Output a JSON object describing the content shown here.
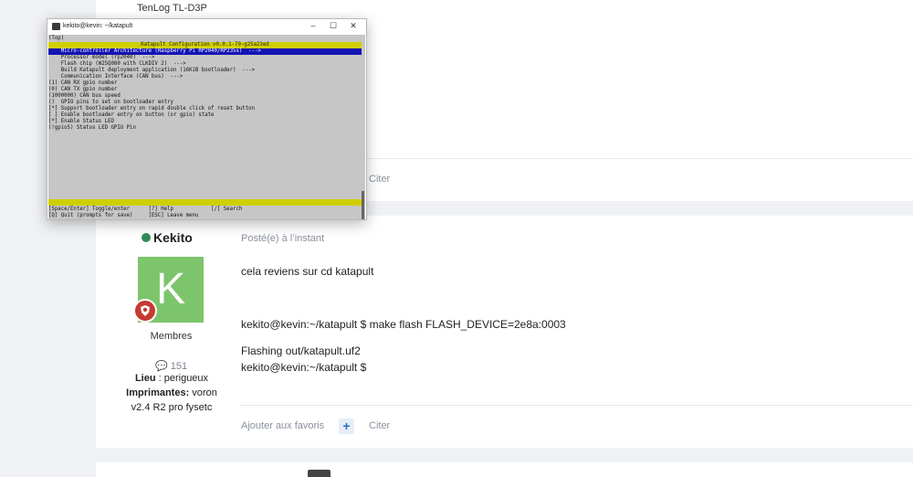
{
  "top_post": {
    "printer_name": "TenLog TL-D3P",
    "cite_label": "Citer"
  },
  "main_post": {
    "author": "Kekito",
    "avatar_letter": "K",
    "group": "Membres",
    "post_count": "151",
    "location_label": "Lieu",
    "location_value": " : perigueux",
    "printers_label": "Imprimantes:",
    "printers_value": " voron",
    "printers_value2": "v2.4 R2 pro fysetc",
    "posted": "Posté(e) à l’instant",
    "lines": [
      "cela reviens sur cd katapult",
      "kekito@kevin:~/katapult $ make flash FLASH_DEVICE=2e8a:0003",
      " Flashing out/katapult.uf2",
      "kekito@kevin:~/katapult $"
    ],
    "favorite_label": "Ajouter aux favoris",
    "plus_label": "+",
    "cite_label": "Citer"
  },
  "terminal_window": {
    "title": "kekito@kevin: ~/katapult",
    "controls": {
      "minimize": "–",
      "maximize": "☐",
      "close": "✕"
    },
    "top_tag": "(Top)",
    "config_title": "Katapult Configuration v0.0.1-79-g25a23ed",
    "lines": [
      "    Micro-controller Architecture (Raspberry Pi RP2040/RP235x)  --->",
      "    Processor model (rp2040)  --->",
      "    Flash chip (W25Q080 with CLKDIV 2)  --->",
      "    Build Katapult deployment application (16KiB bootloader)  --->",
      "    Communication Interface (CAN bus)  --->",
      "(1) CAN RX gpio number",
      "(0) CAN TX gpio number",
      "(1000000) CAN bus speed",
      "()  GPIO pins to set on bootloader entry",
      "[*] Support bootloader entry on rapid double click of reset button",
      "[ ] Enable bootloader entry on button (or gpio) state",
      "[*] Enable Status LED",
      "(!gpio5) Status LED GPIO Pin"
    ],
    "footer": [
      "[Space/Enter] Toggle/enter      [?] Help            [/] Search",
      "[Q] Quit (prompts for save)     [ESC] Leave menu"
    ],
    "colors": {
      "title_bar": "#cfcf00",
      "selection": "#1414b4",
      "background": "#c6c6c6"
    }
  }
}
